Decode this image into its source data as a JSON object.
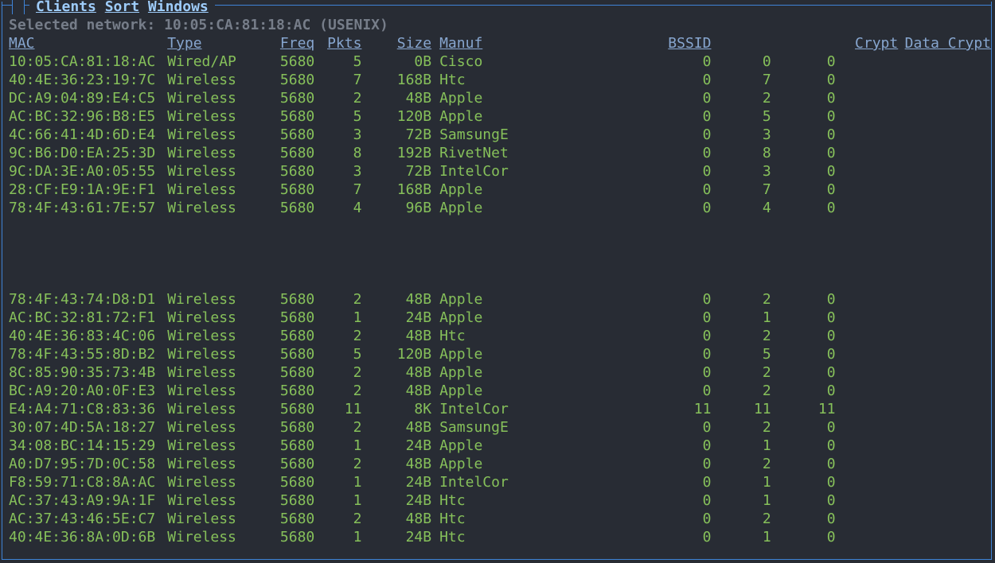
{
  "menu": {
    "clients": "Clients",
    "sort": "Sort",
    "windows": "Windows"
  },
  "selected_prefix": "Selected network: ",
  "selected_value": "10:05:CA:81:18:AC (USENIX)",
  "headers": {
    "mac": "MAC",
    "type": "Type",
    "freq": "Freq",
    "pkts": "Pkts",
    "size": "Size",
    "manuf": "Manuf",
    "bssid": "BSSID",
    "crypt": "Crypt",
    "dcrypt": "Data Crypt"
  },
  "rows_top": [
    {
      "mac": "10:05:CA:81:18:AC",
      "type": "Wired/AP",
      "freq": "5680",
      "pkts": "5",
      "size": "0B",
      "manuf": "Cisco",
      "bssid": "0",
      "n1": "0",
      "n2": "0"
    },
    {
      "mac": "40:4E:36:23:19:7C",
      "type": "Wireless",
      "freq": "5680",
      "pkts": "7",
      "size": "168B",
      "manuf": "Htc",
      "bssid": "0",
      "n1": "7",
      "n2": "0"
    },
    {
      "mac": "DC:A9:04:89:E4:C5",
      "type": "Wireless",
      "freq": "5680",
      "pkts": "2",
      "size": "48B",
      "manuf": "Apple",
      "bssid": "0",
      "n1": "2",
      "n2": "0"
    },
    {
      "mac": "AC:BC:32:96:B8:E5",
      "type": "Wireless",
      "freq": "5680",
      "pkts": "5",
      "size": "120B",
      "manuf": "Apple",
      "bssid": "0",
      "n1": "5",
      "n2": "0"
    },
    {
      "mac": "4C:66:41:4D:6D:E4",
      "type": "Wireless",
      "freq": "5680",
      "pkts": "3",
      "size": "72B",
      "manuf": "SamsungE",
      "bssid": "0",
      "n1": "3",
      "n2": "0"
    },
    {
      "mac": "9C:B6:D0:EA:25:3D",
      "type": "Wireless",
      "freq": "5680",
      "pkts": "8",
      "size": "192B",
      "manuf": "RivetNet",
      "bssid": "0",
      "n1": "8",
      "n2": "0"
    },
    {
      "mac": "9C:DA:3E:A0:05:55",
      "type": "Wireless",
      "freq": "5680",
      "pkts": "3",
      "size": "72B",
      "manuf": "IntelCor",
      "bssid": "0",
      "n1": "3",
      "n2": "0"
    },
    {
      "mac": "28:CF:E9:1A:9E:F1",
      "type": "Wireless",
      "freq": "5680",
      "pkts": "7",
      "size": "168B",
      "manuf": "Apple",
      "bssid": "0",
      "n1": "7",
      "n2": "0"
    },
    {
      "mac": "78:4F:43:61:7E:57",
      "type": "Wireless",
      "freq": "5680",
      "pkts": "4",
      "size": "96B",
      "manuf": "Apple",
      "bssid": "0",
      "n1": "4",
      "n2": "0"
    }
  ],
  "rows_bottom": [
    {
      "mac": "78:4F:43:74:D8:D1",
      "type": "Wireless",
      "freq": "5680",
      "pkts": "2",
      "size": "48B",
      "manuf": "Apple",
      "bssid": "0",
      "n1": "2",
      "n2": "0"
    },
    {
      "mac": "AC:BC:32:81:72:F1",
      "type": "Wireless",
      "freq": "5680",
      "pkts": "1",
      "size": "24B",
      "manuf": "Apple",
      "bssid": "0",
      "n1": "1",
      "n2": "0"
    },
    {
      "mac": "40:4E:36:83:4C:06",
      "type": "Wireless",
      "freq": "5680",
      "pkts": "2",
      "size": "48B",
      "manuf": "Htc",
      "bssid": "0",
      "n1": "2",
      "n2": "0"
    },
    {
      "mac": "78:4F:43:55:8D:B2",
      "type": "Wireless",
      "freq": "5680",
      "pkts": "5",
      "size": "120B",
      "manuf": "Apple",
      "bssid": "0",
      "n1": "5",
      "n2": "0"
    },
    {
      "mac": "8C:85:90:35:73:4B",
      "type": "Wireless",
      "freq": "5680",
      "pkts": "2",
      "size": "48B",
      "manuf": "Apple",
      "bssid": "0",
      "n1": "2",
      "n2": "0"
    },
    {
      "mac": "BC:A9:20:A0:0F:E3",
      "type": "Wireless",
      "freq": "5680",
      "pkts": "2",
      "size": "48B",
      "manuf": "Apple",
      "bssid": "0",
      "n1": "2",
      "n2": "0"
    },
    {
      "mac": "E4:A4:71:C8:83:36",
      "type": "Wireless",
      "freq": "5680",
      "pkts": "11",
      "size": "8K",
      "manuf": "IntelCor",
      "bssid": "11",
      "n1": "11",
      "n2": "11"
    },
    {
      "mac": "30:07:4D:5A:18:27",
      "type": "Wireless",
      "freq": "5680",
      "pkts": "2",
      "size": "48B",
      "manuf": "SamsungE",
      "bssid": "0",
      "n1": "2",
      "n2": "0"
    },
    {
      "mac": "34:08:BC:14:15:29",
      "type": "Wireless",
      "freq": "5680",
      "pkts": "1",
      "size": "24B",
      "manuf": "Apple",
      "bssid": "0",
      "n1": "1",
      "n2": "0"
    },
    {
      "mac": "A0:D7:95:7D:0C:58",
      "type": "Wireless",
      "freq": "5680",
      "pkts": "2",
      "size": "48B",
      "manuf": "Apple",
      "bssid": "0",
      "n1": "2",
      "n2": "0"
    },
    {
      "mac": "F8:59:71:C8:8A:AC",
      "type": "Wireless",
      "freq": "5680",
      "pkts": "1",
      "size": "24B",
      "manuf": "IntelCor",
      "bssid": "0",
      "n1": "1",
      "n2": "0"
    },
    {
      "mac": "AC:37:43:A9:9A:1F",
      "type": "Wireless",
      "freq": "5680",
      "pkts": "1",
      "size": "24B",
      "manuf": "Htc",
      "bssid": "0",
      "n1": "1",
      "n2": "0"
    },
    {
      "mac": "AC:37:43:46:5E:C7",
      "type": "Wireless",
      "freq": "5680",
      "pkts": "2",
      "size": "48B",
      "manuf": "Htc",
      "bssid": "0",
      "n1": "2",
      "n2": "0"
    },
    {
      "mac": "40:4E:36:8A:0D:6B",
      "type": "Wireless",
      "freq": "5680",
      "pkts": "1",
      "size": "24B",
      "manuf": "Htc",
      "bssid": "0",
      "n1": "1",
      "n2": "0"
    }
  ]
}
